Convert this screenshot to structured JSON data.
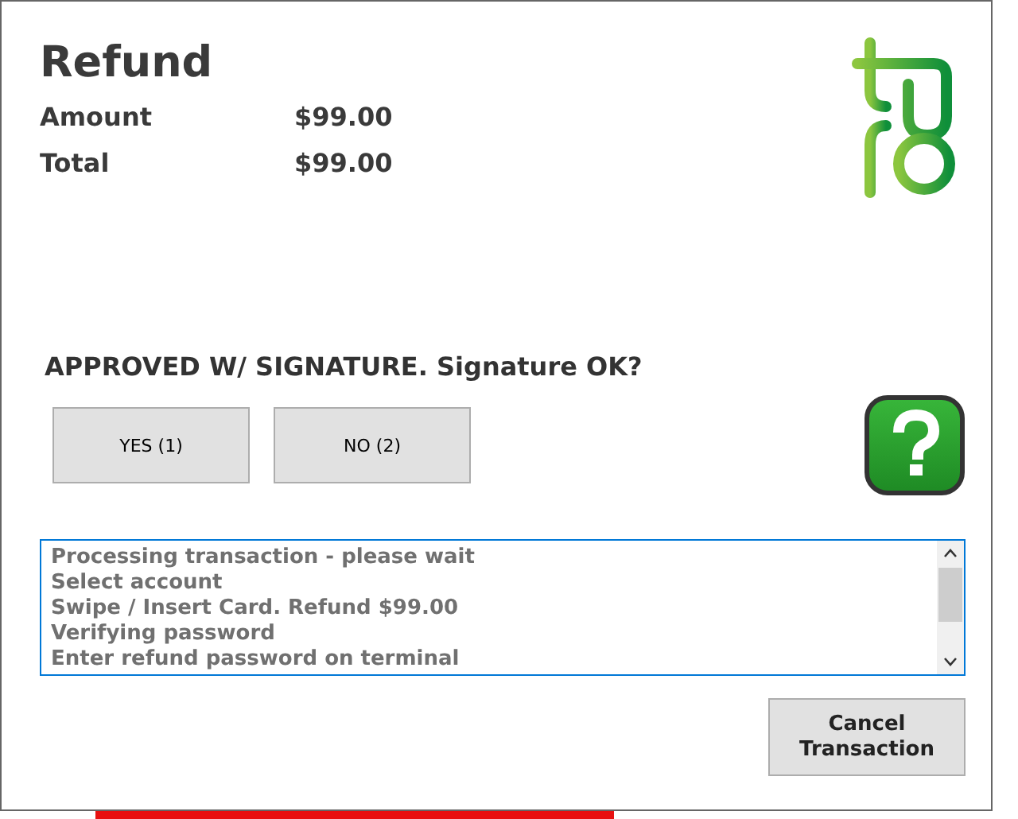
{
  "title": "Refund",
  "summary": [
    {
      "label": "Amount",
      "value": "$99.00"
    },
    {
      "label": "Total",
      "value": "$99.00"
    }
  ],
  "prompt": "APPROVED W/ SIGNATURE. Signature OK?",
  "choices": [
    "YES (1)",
    "NO (2)"
  ],
  "log": [
    "Processing transaction - please wait",
    "Select account",
    "Swipe / Insert Card. Refund $99.00",
    "Verifying password",
    "Enter refund password on terminal"
  ],
  "cancel_button": "Cancel Transaction"
}
